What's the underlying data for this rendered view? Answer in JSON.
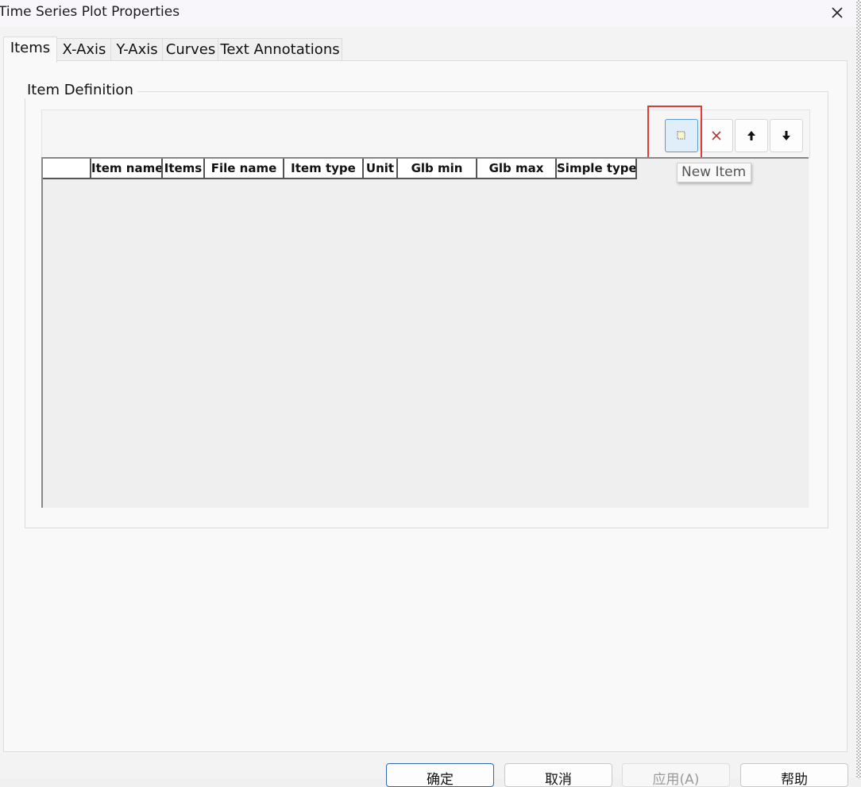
{
  "window": {
    "title": "Time Series Plot Properties",
    "close_icon": "close-icon"
  },
  "tabs": [
    {
      "label": "Items",
      "active": true
    },
    {
      "label": "X-Axis",
      "active": false
    },
    {
      "label": "Y-Axis",
      "active": false
    },
    {
      "label": "Curves",
      "active": false
    },
    {
      "label": "Text Annotations",
      "active": false
    }
  ],
  "item_definition": {
    "group_label": "Item Definition",
    "toolbar": {
      "new_item_icon": "new-item-icon",
      "delete_icon": "delete-x-icon",
      "move_up_icon": "arrow-up-icon",
      "move_down_icon": "arrow-down-icon",
      "tooltip": "New Item"
    },
    "table": {
      "columns": [
        "",
        "Item name",
        "Items",
        "File name",
        "Item type",
        "Unit",
        "Glb min",
        "Glb max",
        "Simple type"
      ],
      "rows": []
    }
  },
  "buttons": {
    "ok": "确定",
    "cancel": "取消",
    "apply": "应用(A)",
    "help": "帮助"
  },
  "colors": {
    "highlight": "#e53935",
    "hot_button": "#e0eefa",
    "default_button_border": "#2c6bb3"
  }
}
